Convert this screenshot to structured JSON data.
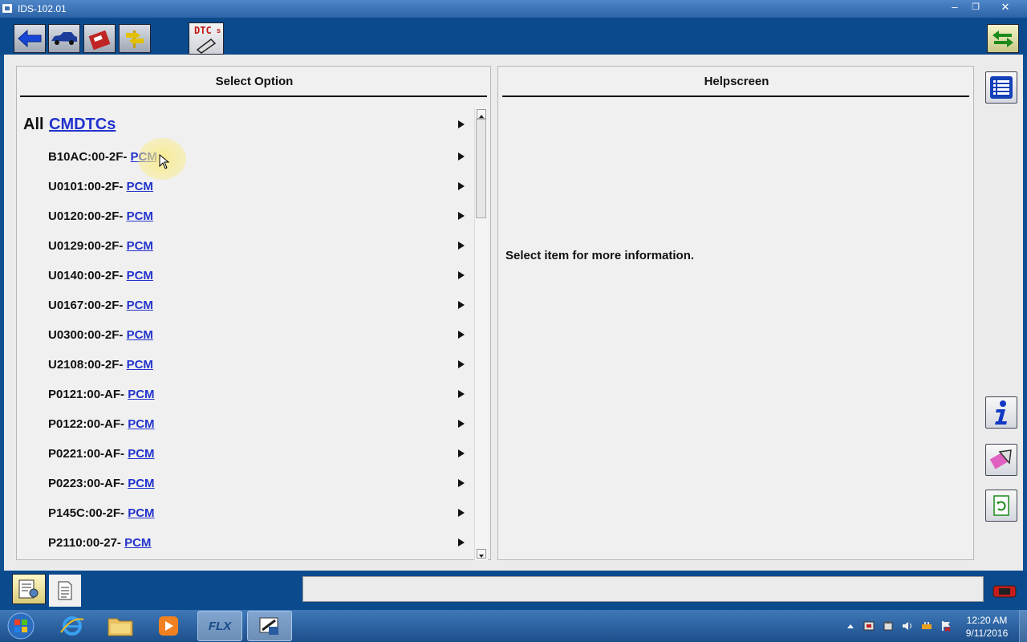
{
  "window": {
    "title": "IDS-102.01",
    "minimize": "–",
    "restore": "❐",
    "close": "✕"
  },
  "toolbar": {
    "dtc_label": "DTC"
  },
  "select_panel": {
    "header": "Select Option",
    "all_prefix": "All",
    "all_link": "CMDTCs",
    "items": [
      {
        "code": "B10AC:00-2F-",
        "module": "PCM"
      },
      {
        "code": "U0101:00-2F-",
        "module": "PCM"
      },
      {
        "code": "U0120:00-2F-",
        "module": "PCM"
      },
      {
        "code": "U0129:00-2F-",
        "module": "PCM"
      },
      {
        "code": "U0140:00-2F-",
        "module": "PCM"
      },
      {
        "code": "U0167:00-2F-",
        "module": "PCM"
      },
      {
        "code": "U0300:00-2F-",
        "module": "PCM"
      },
      {
        "code": "U2108:00-2F-",
        "module": "PCM"
      },
      {
        "code": "P0121:00-AF-",
        "module": "PCM"
      },
      {
        "code": "P0122:00-AF-",
        "module": "PCM"
      },
      {
        "code": "P0221:00-AF-",
        "module": "PCM"
      },
      {
        "code": "P0223:00-AF-",
        "module": "PCM"
      },
      {
        "code": "P145C:00-2F-",
        "module": "PCM"
      },
      {
        "code": "P2110:00-27-",
        "module": "PCM"
      }
    ]
  },
  "help_panel": {
    "header": "Helpscreen",
    "message": "Select item for more information."
  },
  "taskbar": {
    "time": "12:20 AM",
    "date": "9/11/2016",
    "flx_label": "FLX"
  },
  "colors": {
    "link": "#2233cc",
    "toolbar_bg": "#0b4a8c",
    "panel_bg": "#f0f0f0"
  }
}
